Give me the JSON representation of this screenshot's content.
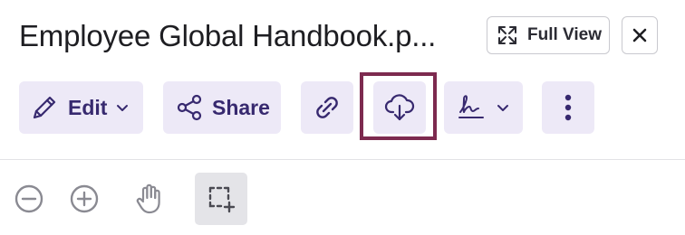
{
  "document": {
    "title": "Employee Global Handbook.p..."
  },
  "header": {
    "full_view_label": "Full View",
    "full_view_icon": "expand-icon",
    "close_icon": "close-icon"
  },
  "toolbar": {
    "edit_label": "Edit",
    "share_label": "Share",
    "icons": [
      "pencil-icon",
      "share-icon",
      "link-icon",
      "cloud-download-icon",
      "signature-icon",
      "more-vertical-icon"
    ],
    "highlighted_item": "download"
  },
  "viewer_tools": {
    "icons": [
      "zoom-out-icon",
      "zoom-in-icon",
      "hand-pan-icon",
      "area-select-icon"
    ],
    "active_tool": "area-select"
  },
  "colors": {
    "accent": "#37296f",
    "button_bg": "#ede9f7",
    "highlight_border": "#7d2a4f",
    "active_tool_bg": "#e4e4e8"
  }
}
